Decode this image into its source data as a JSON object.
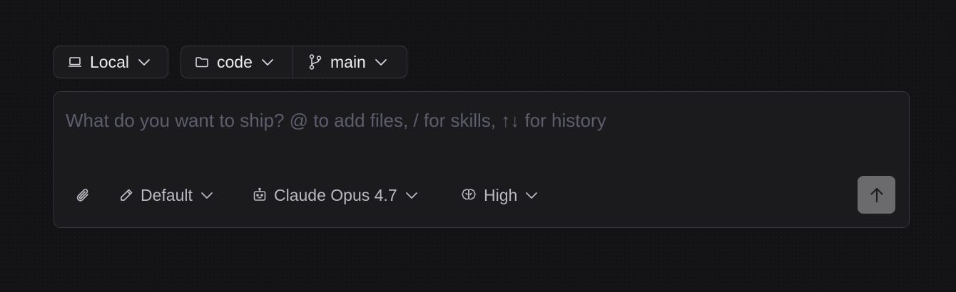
{
  "context_bar": {
    "environment": {
      "label": "Local",
      "icon": "laptop-icon"
    },
    "folder": {
      "label": "code",
      "icon": "folder-icon"
    },
    "branch": {
      "label": "main",
      "icon": "git-branch-icon"
    }
  },
  "composer": {
    "placeholder": "What do you want to ship? @ to add files, / for skills, ↑↓ for history",
    "value": ""
  },
  "toolbar": {
    "attach": {
      "icon": "paperclip-icon"
    },
    "mode": {
      "label": "Default",
      "icon": "pencil-icon"
    },
    "model": {
      "label": "Claude Opus 4.7",
      "icon": "robot-icon"
    },
    "effort": {
      "label": "High",
      "icon": "brain-icon"
    },
    "send": {
      "icon": "arrow-up-icon"
    }
  },
  "colors": {
    "background": "#131315",
    "surface": "#1b1b1e",
    "border": "#35353a",
    "text": "#ececef",
    "muted_text": "#b9b9c2",
    "placeholder": "#5d5d6e",
    "send_button": "#6b6b6e"
  }
}
